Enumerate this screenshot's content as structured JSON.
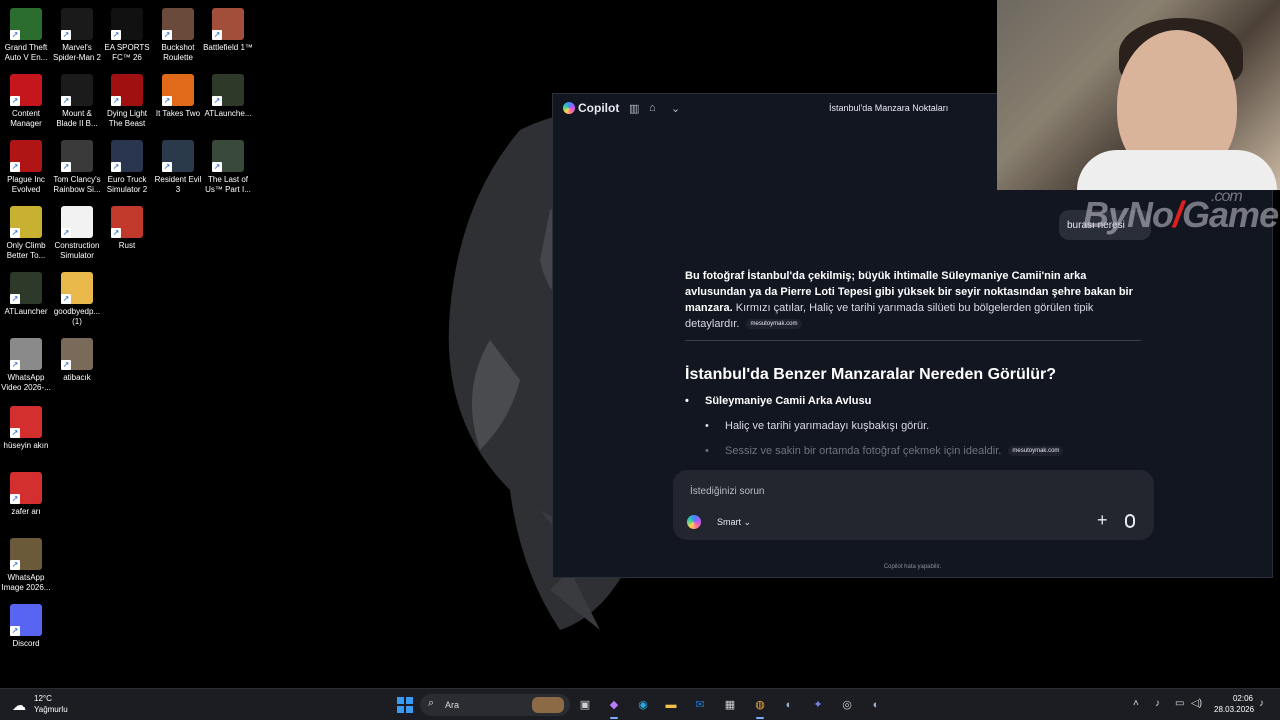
{
  "desktop": {
    "icons": [
      {
        "label": "Grand Theft Auto V En...",
        "icon": "gta-icon",
        "color": "#2b6d2f"
      },
      {
        "label": "Marvel's Spider-Man 2",
        "icon": "spiderman-icon",
        "color": "#1a1a1a"
      },
      {
        "label": "EA SPORTS FC™ 26",
        "icon": "fc26-icon",
        "color": "#111111"
      },
      {
        "label": "Buckshot Roulette",
        "icon": "buckshot-icon",
        "color": "#6a4a3a"
      },
      {
        "label": "Battlefield 1™",
        "icon": "battlefield-icon",
        "color": "#a14e3a"
      },
      {
        "label": "Content Manager",
        "icon": "content-manager-icon",
        "color": "#c4161c"
      },
      {
        "label": "Mount & Blade II B...",
        "icon": "mount-blade-icon",
        "color": "#1b1b1b"
      },
      {
        "label": "Dying Light The Beast",
        "icon": "dying-light-icon",
        "color": "#a01010"
      },
      {
        "label": "It Takes Two",
        "icon": "it-takes-two-icon",
        "color": "#e06a1a"
      },
      {
        "label": "ATLaunche...",
        "icon": "atlauncher-icon",
        "color": "#2d3a2a"
      },
      {
        "label": "Plague Inc Evolved",
        "icon": "plague-icon",
        "color": "#b01515"
      },
      {
        "label": "Tom Clancy's Rainbow Si...",
        "icon": "rainbow-six-icon",
        "color": "#3a3a3a"
      },
      {
        "label": "Euro Truck Simulator 2",
        "icon": "ets2-icon",
        "color": "#2a3550"
      },
      {
        "label": "Resident Evil 3",
        "icon": "resident-evil-icon",
        "color": "#2a3a4a"
      },
      {
        "label": "The Last of Us™ Part I...",
        "icon": "last-of-us-icon",
        "color": "#3a4a3a"
      },
      {
        "label": "Only Climb Better To...",
        "icon": "only-climb-icon",
        "color": "#c8b030"
      },
      {
        "label": "Construction Simulator",
        "icon": "file-icon",
        "color": "#f2f2f2"
      },
      {
        "label": "Rust",
        "icon": "rust-icon",
        "color": "#c0392b"
      },
      {
        "label": "ATLauncher",
        "icon": "atlauncher-icon",
        "color": "#2d3a2a"
      },
      {
        "label": "goodbyedp... (1)",
        "icon": "folder-icon",
        "color": "#e8b84a"
      },
      {
        "label": "WhatsApp Video 2026-...",
        "icon": "video-thumb-icon",
        "color": "#8a8a8a"
      },
      {
        "label": "atibacık",
        "icon": "image-thumb-icon",
        "color": "#7a6a5a"
      },
      {
        "label": "hüseyin akın",
        "icon": "pdf-icon",
        "color": "#d32f2f"
      },
      {
        "label": "zafer arı",
        "icon": "pdf-icon",
        "color": "#d32f2f"
      },
      {
        "label": "WhatsApp Image 2026...",
        "icon": "image-thumb-icon",
        "color": "#6a5a3a"
      },
      {
        "label": "Discord",
        "icon": "discord-icon",
        "color": "#5865f2"
      }
    ]
  },
  "copilot": {
    "app_name": "Copilot",
    "conversation_title": "İstanbul'da Manzara Noktaları",
    "user_message": "burası neresi",
    "watermark": {
      "prefix": "ByNo",
      "suffix": "Game",
      "tld": ".com"
    },
    "answer_bold": "Bu fotoğraf İstanbul'da çekilmiş; büyük ihtimalle Süleymaniye Camii'nin arka avlusundan ya da Pierre Loti Tepesi gibi yüksek bir seyir noktasından şehre bakan bir manzara.",
    "answer_rest": " Kırmızı çatılar, Haliç ve tarihi yarımada silüeti bu bölgelerden görülen tipik detaylardır.",
    "source_chip_1": "mesutoymak.com",
    "heading": "İstanbul'da Benzer Manzaralar Nereden Görülür?",
    "bullet_1": "Süleymaniye Camii Arka Avlusu",
    "sub_bullet_1": "Haliç ve tarihi yarımadayı kuşbakışı görür.",
    "sub_bullet_2": "Sessiz ve sakin bir ortamda fotoğraf çekmek için idealdir.",
    "source_chip_2": "mesutoymak.com",
    "input_placeholder": "İstediğinizi sorun",
    "mode_label": "Smart",
    "disclaimer": "Copilot hata yapabilir."
  },
  "taskbar": {
    "weather_temp": "12°C",
    "weather_desc": "Yağmurlu",
    "search_placeholder": "Ara",
    "time": "02:06",
    "date": "28.03.2026",
    "apps": [
      {
        "name": "task-view-icon",
        "glyph": "▣",
        "color": "#cfcfcf",
        "active": false
      },
      {
        "name": "copilot-app-icon",
        "glyph": "◆",
        "color": "#b97cff",
        "active": true
      },
      {
        "name": "edge-icon",
        "glyph": "◉",
        "color": "#2ca5e0",
        "active": false
      },
      {
        "name": "file-explorer-icon",
        "glyph": "▬",
        "color": "#f3c14b",
        "active": false
      },
      {
        "name": "outlook-icon",
        "glyph": "✉",
        "color": "#1f73d1",
        "active": false
      },
      {
        "name": "store-icon",
        "glyph": "▦",
        "color": "#cfcfcf",
        "active": false
      },
      {
        "name": "chrome-icon",
        "glyph": "◍",
        "color": "#e9a93b",
        "active": true
      },
      {
        "name": "steam-icon",
        "glyph": "◐",
        "color": "#9ab4d8",
        "active": false
      },
      {
        "name": "teams-icon",
        "glyph": "✦",
        "color": "#7b83eb",
        "active": false
      },
      {
        "name": "obs-icon",
        "glyph": "◎",
        "color": "#cfcfcf",
        "active": false
      },
      {
        "name": "steam-icon-2",
        "glyph": "◐",
        "color": "#9ab4d8",
        "active": false
      }
    ]
  }
}
